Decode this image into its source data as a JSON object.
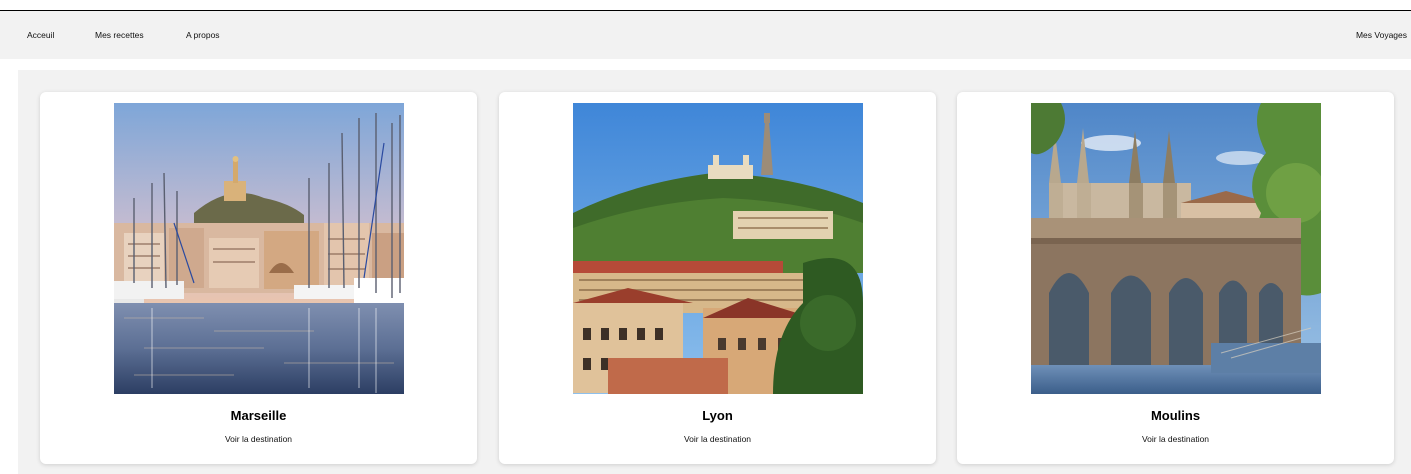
{
  "nav": {
    "links": [
      "Acceuil",
      "Mes recettes",
      "A propos"
    ],
    "brand": "Mes Voyages"
  },
  "cards": [
    {
      "title": "Marseille",
      "link_label": "Voir la destination"
    },
    {
      "title": "Lyon",
      "link_label": "Voir la destination"
    },
    {
      "title": "Moulins",
      "link_label": "Voir la destination"
    }
  ],
  "colors": {
    "navbar_bg": "#f2f2f2",
    "page_bg": "#f2f2f2",
    "card_bg": "#ffffff"
  }
}
